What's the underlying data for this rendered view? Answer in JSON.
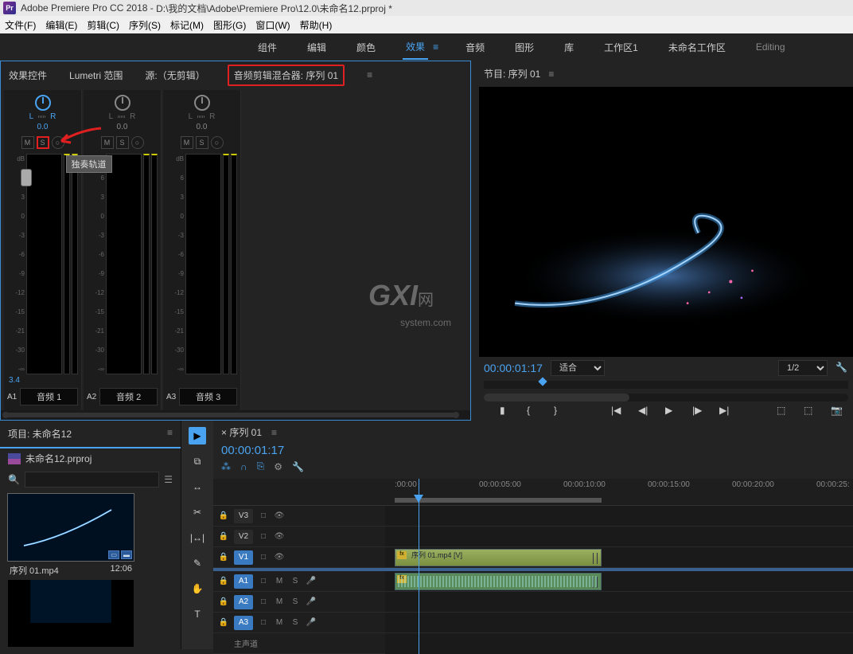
{
  "titlebar": {
    "app_name": "Adobe Premiere Pro CC 2018",
    "project_path": "D:\\我的文档\\Adobe\\Premiere Pro\\12.0\\未命名12.prproj *"
  },
  "menubar": {
    "items": [
      "文件(F)",
      "编辑(E)",
      "剪辑(C)",
      "序列(S)",
      "标记(M)",
      "图形(G)",
      "窗口(W)",
      "帮助(H)"
    ]
  },
  "workspace": {
    "tabs": [
      "组件",
      "编辑",
      "颜色",
      "效果",
      "音频",
      "图形",
      "库",
      "工作区1",
      "未命名工作区"
    ],
    "active": "效果",
    "editing_label": "Editing"
  },
  "audio_mixer": {
    "panel_tabs": {
      "effect_controls": "效果控件",
      "lumetri": "Lumetri 范围",
      "source": "源:（无剪辑）",
      "mixer": "音频剪辑混合器: 序列 01"
    },
    "tooltip_solo": "独奏轨道",
    "db_labels": [
      "dB",
      "6",
      "3",
      "0",
      "-3",
      "-6",
      "-9",
      "-12",
      "-15",
      "-21",
      "-30",
      "-∞"
    ],
    "lr": {
      "l": "L",
      "r": "R"
    },
    "channels": [
      {
        "id": "A1",
        "name": "音频 1",
        "pan": "0.0",
        "volume": "3.4",
        "active": true
      },
      {
        "id": "A2",
        "name": "音频 2",
        "pan": "0.0",
        "volume": "",
        "active": false
      },
      {
        "id": "A3",
        "name": "音频 3",
        "pan": "0.0",
        "volume": "",
        "active": false
      }
    ],
    "mso": {
      "m": "M",
      "s": "S"
    }
  },
  "program_monitor": {
    "title": "节目: 序列 01",
    "timecode": "00:00:01:17",
    "fit": "适合",
    "zoom": "1/2"
  },
  "project": {
    "title": "项目: 未命名12",
    "subtitle": "未命名12.prproj",
    "items": [
      {
        "name": "序列 01.mp4",
        "duration": "12:06"
      }
    ]
  },
  "timeline": {
    "title": "× 序列 01",
    "timecode": "00:00:01:17",
    "ruler": [
      ":00:00",
      "00:00:05:00",
      "00:00:10:00",
      "00:00:15:00",
      "00:00:20:00",
      "00:00:25:"
    ],
    "video_tracks": [
      "V3",
      "V2",
      "V1"
    ],
    "audio_tracks": [
      "A1",
      "A2",
      "A3"
    ],
    "clip_v_name": "序列 01.mp4 [V]",
    "master": "主声道"
  },
  "watermark": {
    "brand": "GXI",
    "suffix": "网",
    "sub": "system.com"
  }
}
